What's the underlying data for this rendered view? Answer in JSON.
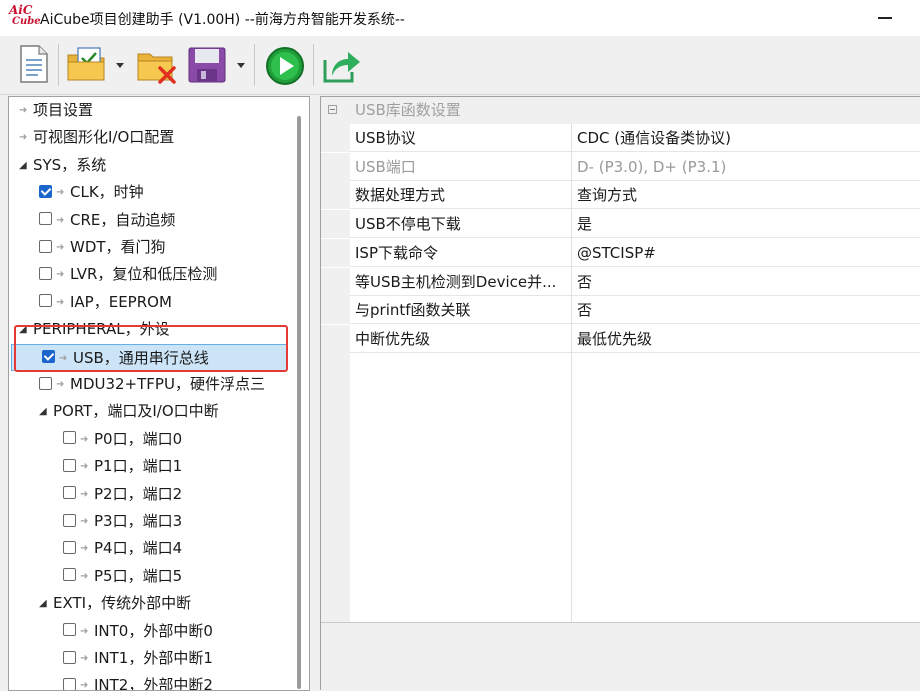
{
  "window": {
    "logo_top": "AiC",
    "logo_bottom": "Cube",
    "title": "AiCube项目创建助手 (V1.00H) --前海方舟智能开发系统--"
  },
  "toolbar": {
    "buttons": [
      "new-document-icon",
      "open-project-icon",
      "close-project-icon",
      "save-icon",
      "run-icon",
      "export-icon"
    ]
  },
  "tree": {
    "items": [
      {
        "label": "项目设置",
        "level": 0,
        "kind": "arrow"
      },
      {
        "label": "可视图形化I/O口配置",
        "level": 0,
        "kind": "arrow"
      },
      {
        "label": "SYS，系统",
        "level": 0,
        "kind": "expanded"
      },
      {
        "label": "CLK，时钟",
        "level": 1,
        "checked": true
      },
      {
        "label": "CRE，自动追频",
        "level": 1,
        "checked": false
      },
      {
        "label": "WDT，看门狗",
        "level": 1,
        "checked": false
      },
      {
        "label": "LVR，复位和低压检测",
        "level": 1,
        "checked": false
      },
      {
        "label": "IAP，EEPROM",
        "level": 1,
        "checked": false
      },
      {
        "label": "PERIPHERAL，外设",
        "level": 0,
        "kind": "expanded"
      },
      {
        "label": "USB，通用串行总线",
        "level": 1,
        "checked": true,
        "selected": true
      },
      {
        "label": "MDU32+TFPU，硬件浮点三",
        "level": 1,
        "checked": false
      },
      {
        "label": "PORT，端口及I/O口中断",
        "level": 1,
        "kind": "expanded"
      },
      {
        "label": "P0口，端口0",
        "level": 2,
        "checked": false
      },
      {
        "label": "P1口，端口1",
        "level": 2,
        "checked": false
      },
      {
        "label": "P2口，端口2",
        "level": 2,
        "checked": false
      },
      {
        "label": "P3口，端口3",
        "level": 2,
        "checked": false
      },
      {
        "label": "P4口，端口4",
        "level": 2,
        "checked": false
      },
      {
        "label": "P5口，端口5",
        "level": 2,
        "checked": false
      },
      {
        "label": "EXTI，传统外部中断",
        "level": 1,
        "kind": "expanded"
      },
      {
        "label": "INT0，外部中断0",
        "level": 2,
        "checked": false
      },
      {
        "label": "INT1，外部中断1",
        "level": 2,
        "checked": false
      },
      {
        "label": "INT2，外部中断2",
        "level": 2,
        "checked": false
      }
    ]
  },
  "properties": {
    "category": "USB库函数设置",
    "rows": [
      {
        "name": "USB协议",
        "value": "CDC (通信设备类协议)"
      },
      {
        "name": "USB端口",
        "value": "D- (P3.0), D+ (P3.1)",
        "dim": true
      },
      {
        "name": "数据处理方式",
        "value": "查询方式"
      },
      {
        "name": "USB不停电下载",
        "value": "是"
      },
      {
        "name": "ISP下载命令",
        "value": "@STCISP#"
      },
      {
        "name": "等USB主机检测到Device并...",
        "value": "否"
      },
      {
        "name": "与printf函数关联",
        "value": "否"
      },
      {
        "name": "中断优先级",
        "value": "最低优先级"
      }
    ]
  }
}
